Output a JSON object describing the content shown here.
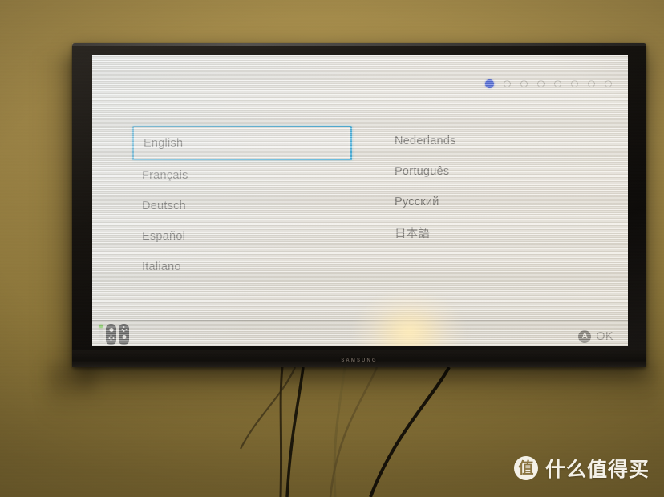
{
  "scene": {
    "device_brand": "SAMSUNG",
    "wall_color": "#9a8245",
    "bezel_color": "#14110e"
  },
  "console_ui": {
    "screen_title": "",
    "page_dots": {
      "total": 8,
      "active_index": 0,
      "active_color": "#1b3fd8",
      "inactive_color": "#f0eee8"
    },
    "selection": {
      "selected_label": "English",
      "highlight_color": "#1ba3de"
    },
    "languages_left": [
      {
        "label": "English",
        "selected": true
      },
      {
        "label": "Français",
        "selected": false
      },
      {
        "label": "Deutsch",
        "selected": false
      },
      {
        "label": "Español",
        "selected": false
      },
      {
        "label": "Italiano",
        "selected": false
      }
    ],
    "languages_right": [
      {
        "label": "Nederlands",
        "selected": false
      },
      {
        "label": "Português",
        "selected": false
      },
      {
        "label": "Русский",
        "selected": false
      },
      {
        "label": "日本語",
        "selected": false
      }
    ],
    "footer": {
      "confirm_button_glyph": "A",
      "confirm_label": "OK",
      "controller_icon": "joycon-pair-icon",
      "player_led_active": 1,
      "player_led_total": 4
    }
  },
  "watermark": {
    "logo_glyph": "值",
    "text": "什么值得买"
  }
}
